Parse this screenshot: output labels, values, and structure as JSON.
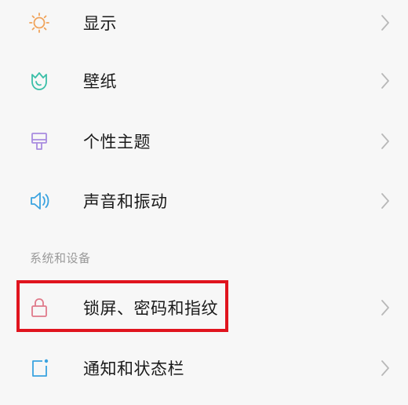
{
  "settings": {
    "items": [
      {
        "label": "显示",
        "icon": "sun-icon",
        "color": "#f0a35a"
      },
      {
        "label": "壁纸",
        "icon": "tulip-icon",
        "color": "#3bbfa8"
      },
      {
        "label": "个性主题",
        "icon": "brush-icon",
        "color": "#a88ce0"
      },
      {
        "label": "声音和振动",
        "icon": "speaker-icon",
        "color": "#3aa3e0"
      }
    ],
    "section_header": "系统和设备",
    "system_items": [
      {
        "label": "锁屏、密码和指纹",
        "icon": "lock-icon",
        "color": "#e07a8a"
      },
      {
        "label": "通知和状态栏",
        "icon": "notification-icon",
        "color": "#3aa3e0"
      }
    ]
  },
  "annotation": {
    "highlight_color": "#e0141e"
  }
}
